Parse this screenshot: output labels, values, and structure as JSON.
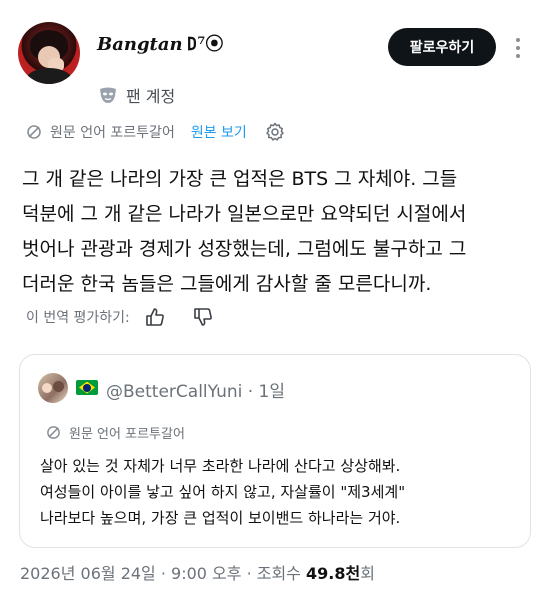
{
  "author": {
    "name": "Bangtan",
    "name_symbols": "𐌃⁷⦿",
    "badge_label": "팬 계정"
  },
  "follow_button": {
    "label": "팔로우하기"
  },
  "translation": {
    "source_label": "원문 언어 포르투갈어",
    "view_original": "원본 보기"
  },
  "post": {
    "lines": [
      "그 개 같은 나라의 가장 큰 업적은 BTS 그 자체야. 그들",
      "덕분에 그 개 같은 나라가 일본으로만 요약되던 시절에서",
      "벗어나 관광과 경제가 성장했는데, 그럼에도 불구하고 그",
      "더러운 한국 놈들은 그들에게 감사할 줄 모른다니까."
    ]
  },
  "rate_translation": {
    "label": "이 번역 평가하기:"
  },
  "quote": {
    "handle": "@BetterCallYuni",
    "time": "· 1일",
    "translation_label": "원문 언어 포르투갈어",
    "lines": [
      "살아 있는 것 자체가 너무 초라한 나라에 산다고 상상해봐.",
      "여성들이 아이를 낳고 싶어 하지 않고, 자살률이 \"제3세계\"",
      "나라보다 높으며, 가장 큰 업적이 보이밴드 하나라는 거야."
    ]
  },
  "meta": {
    "datetime": "2026년 06월 24일 · 9:00 오후 · 조회수 ",
    "views": "49.8천",
    "views_suffix": "회"
  },
  "icons": [
    "translate-icon",
    "gear-icon",
    "thumbs-up-icon",
    "thumbs-down-icon",
    "more-icon",
    "mask-icon",
    "brazil-flag-icon"
  ]
}
